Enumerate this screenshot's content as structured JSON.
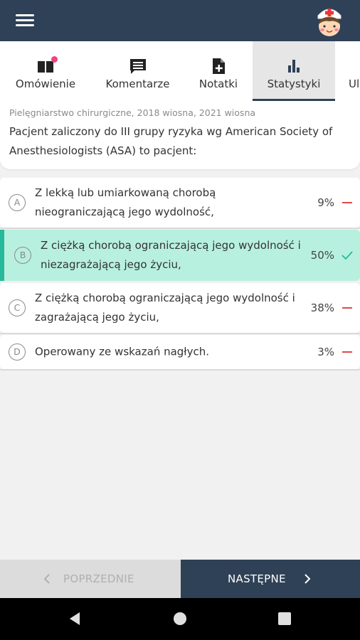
{
  "appbar": {
    "menu_icon": "hamburger-menu-icon",
    "avatar_icon": "nurse-avatar-icon"
  },
  "tabs": [
    {
      "label": "Omówienie",
      "icon": "book-icon",
      "has_badge": true
    },
    {
      "label": "Komentarze",
      "icon": "comment-icon"
    },
    {
      "label": "Notatki",
      "icon": "note-add-icon"
    },
    {
      "label": "Statystyki",
      "icon": "bar-chart-icon",
      "active": true
    },
    {
      "label": "Ul",
      "icon": "favorite-icon"
    }
  ],
  "question": {
    "source": "Pielęgniarstwo chirurgiczne, 2018 wiosna, 2021 wiosna",
    "text": "Pacjent zaliczony do III grupy ryzyka wg American Society of Anesthesiologists (ASA) to pacjent:"
  },
  "answers": [
    {
      "letter": "A",
      "text": "Z lekką lub umiarkowaną chorobą nieograniczającą jego wydolność,",
      "percent": "9%",
      "correct": false
    },
    {
      "letter": "B",
      "text": "Z ciężką chorobą ograniczającą jego wydolność i niezagrażającą jego życiu,",
      "percent": "50%",
      "correct": true
    },
    {
      "letter": "C",
      "text": "Z ciężką chorobą ograniczającą jego wydolność i zagrażającą jego życiu,",
      "percent": "38%",
      "correct": false
    },
    {
      "letter": "D",
      "text": "Operowany ze wskazań nagłych.",
      "percent": "3%",
      "correct": false
    }
  ],
  "navigation": {
    "prev_label": "POPRZEDNIE",
    "next_label": "NASTĘPNE"
  },
  "colors": {
    "primary": "#2f4156",
    "correct_bg": "#b8f0df",
    "correct_accent": "#26b99a",
    "wrong": "#e04a4a",
    "badge": "#f0457a"
  }
}
